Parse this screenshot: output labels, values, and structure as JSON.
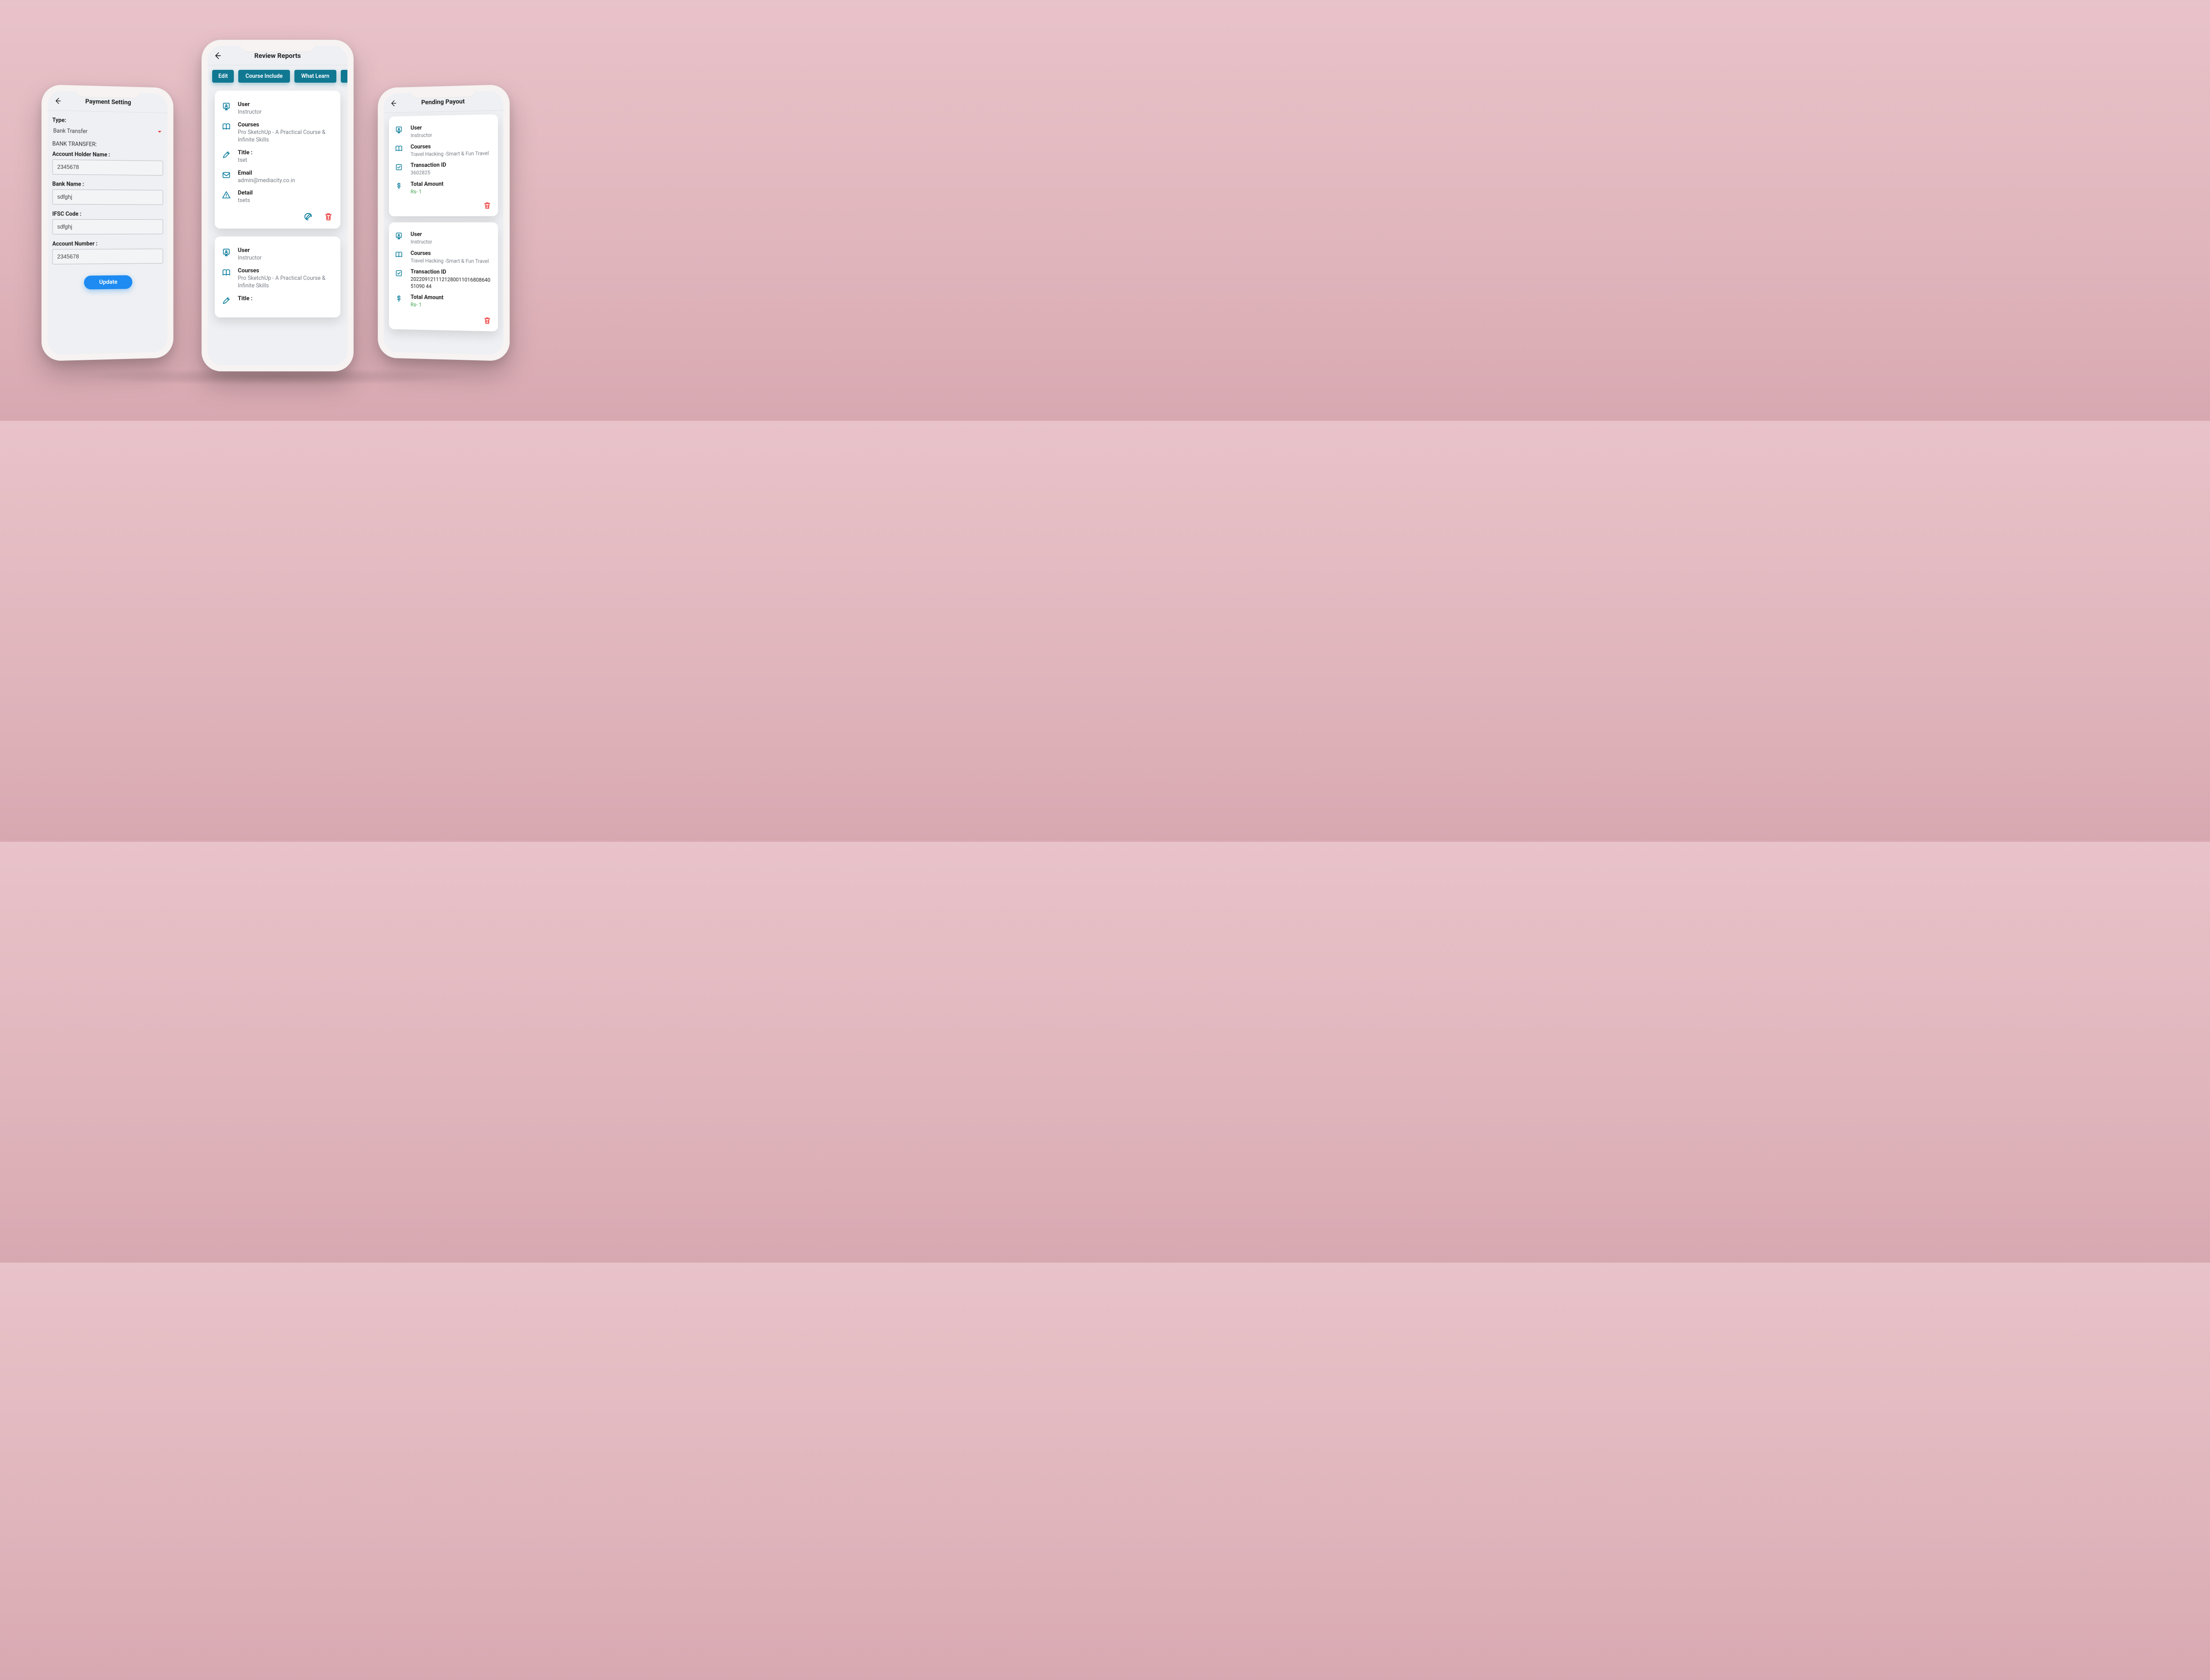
{
  "colors": {
    "accent": "#117892",
    "icon": "#0a7c9b",
    "danger": "#e44",
    "primary_btn": "#1d8bf1",
    "green": "#3aa24a"
  },
  "phone1": {
    "title": "Payment Setting",
    "type_label": "Type:",
    "type_value": "Bank Transfer",
    "section": "BANK TRANSFER:",
    "fields": {
      "holder_label": "Account Holder Name :",
      "holder_value": "2345678",
      "bank_label": "Bank Name :",
      "bank_value": "sdfghj",
      "ifsc_label": "IFSC Code :",
      "ifsc_value": "sdfghj",
      "acct_label": "Account Number :",
      "acct_value": "2345678"
    },
    "update": "Update"
  },
  "phone2": {
    "title": "Review Reports",
    "tabs": {
      "edit": "Edit",
      "include": "Course Include",
      "learn": "What Learn"
    },
    "card1": {
      "user_k": "User",
      "user_v": "Instructor",
      "courses_k": "Courses",
      "courses_v": "Pro SketchUp  - A Practical Course &  Infinite Skills",
      "title_k": "Title :",
      "title_v": "tset",
      "email_k": "Email",
      "email_v": "admin@mediacity.co.in",
      "detail_k": "Detail",
      "detail_v": "tsets"
    },
    "card2": {
      "user_k": "User",
      "user_v": "Instructor",
      "courses_k": "Courses",
      "courses_v": "Pro SketchUp  - A Practical Course &  Infinite Skills",
      "title_k": "Title :"
    }
  },
  "phone3": {
    "title": "Pending Payout",
    "card1": {
      "user_k": "User",
      "user_v": "Instructor",
      "courses_k": "Courses",
      "courses_v": "Travel Hacking -Smart & Fun Travel",
      "txn_k": "Transaction ID",
      "txn_v": "3602825",
      "amt_k": "Total Amount",
      "amt_v": "Rs- 1"
    },
    "card2": {
      "user_k": "User",
      "user_v": "Instructor",
      "courses_k": "Courses",
      "courses_v": "Travel Hacking -Smart & Fun Travel",
      "txn_k": "Transaction ID",
      "txn_v": "202209121112128001101680864051090 44",
      "amt_k": "Total Amount",
      "amt_v": "Rs- 1"
    }
  }
}
